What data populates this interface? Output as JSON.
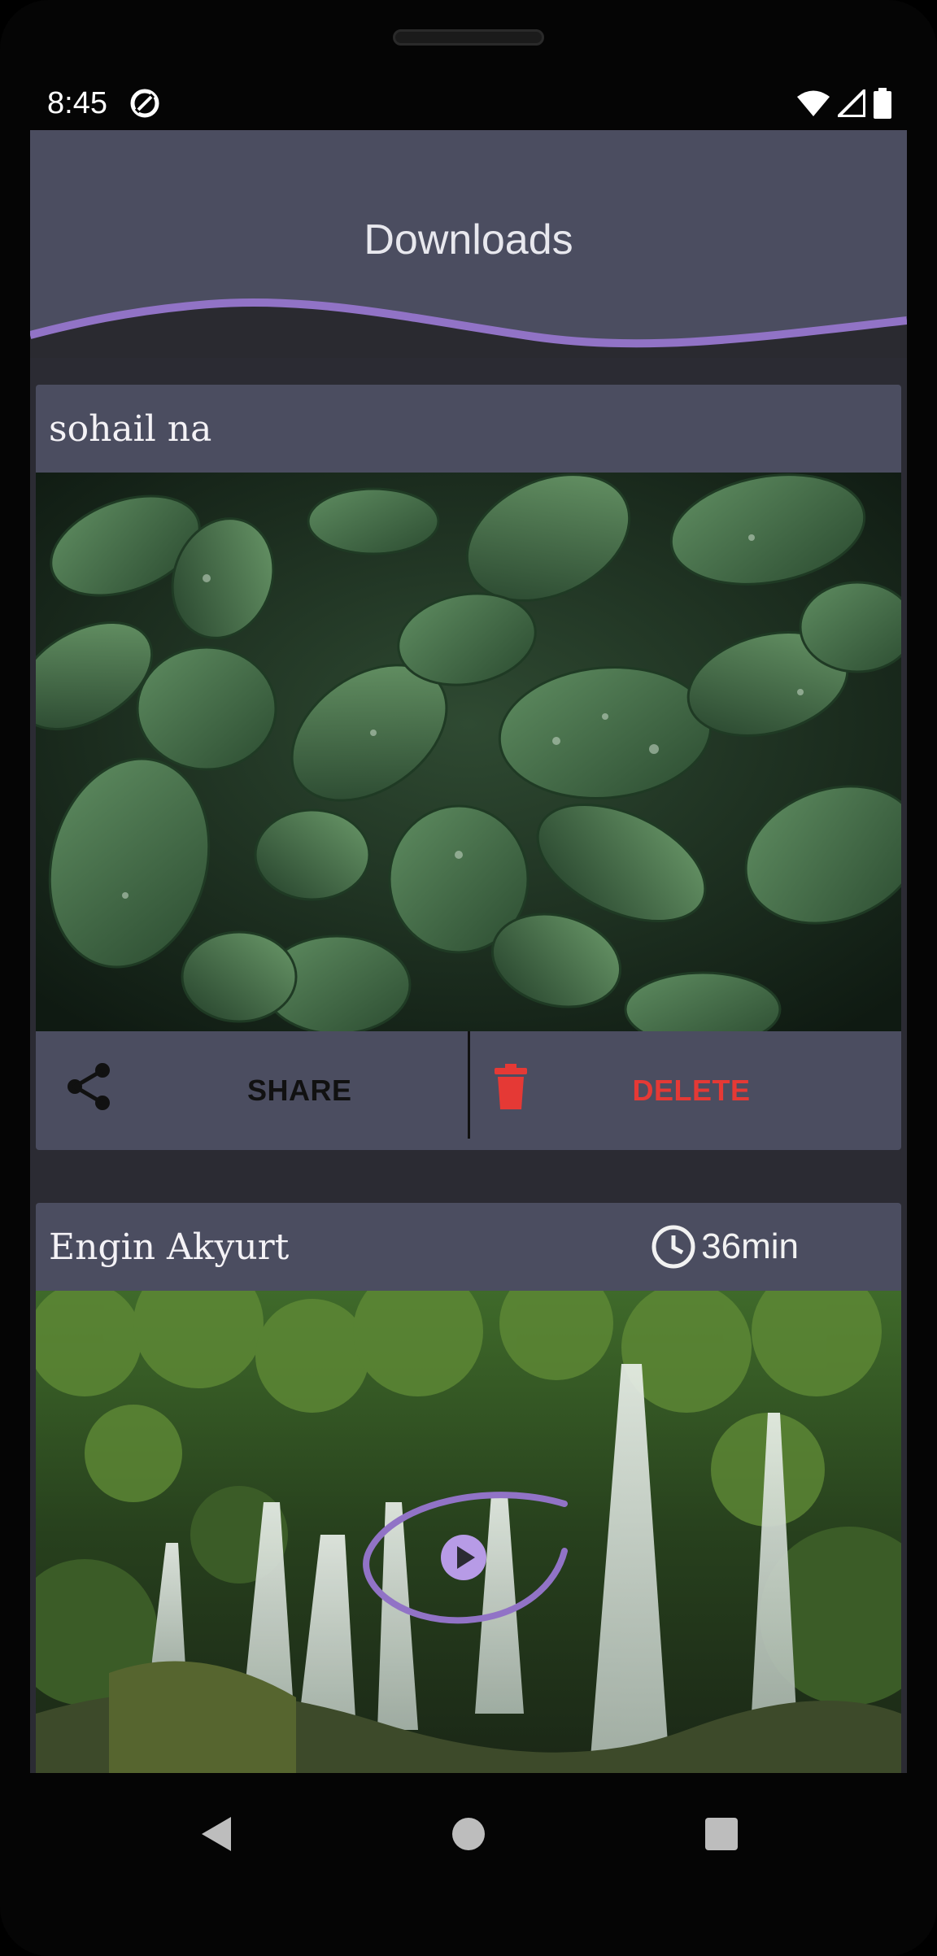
{
  "status_bar": {
    "time": "8:45"
  },
  "app": {
    "title": "Downloads",
    "accent": "#9173c6",
    "delete_color": "#e53935"
  },
  "cards": [
    {
      "author": "sohail na",
      "image": "green-leaves-with-water-drops",
      "actions": {
        "share_label": "SHARE",
        "delete_label": "DELETE"
      }
    },
    {
      "author": "Engin Akyurt",
      "duration": "36min",
      "image": "waterfall-in-forest"
    }
  ],
  "icons": [
    "sync-icon",
    "wifi-icon",
    "signal-icon",
    "battery-icon",
    "share-icon",
    "trash-icon",
    "clock-icon",
    "play-icon",
    "back-icon",
    "home-icon",
    "recents-icon"
  ]
}
